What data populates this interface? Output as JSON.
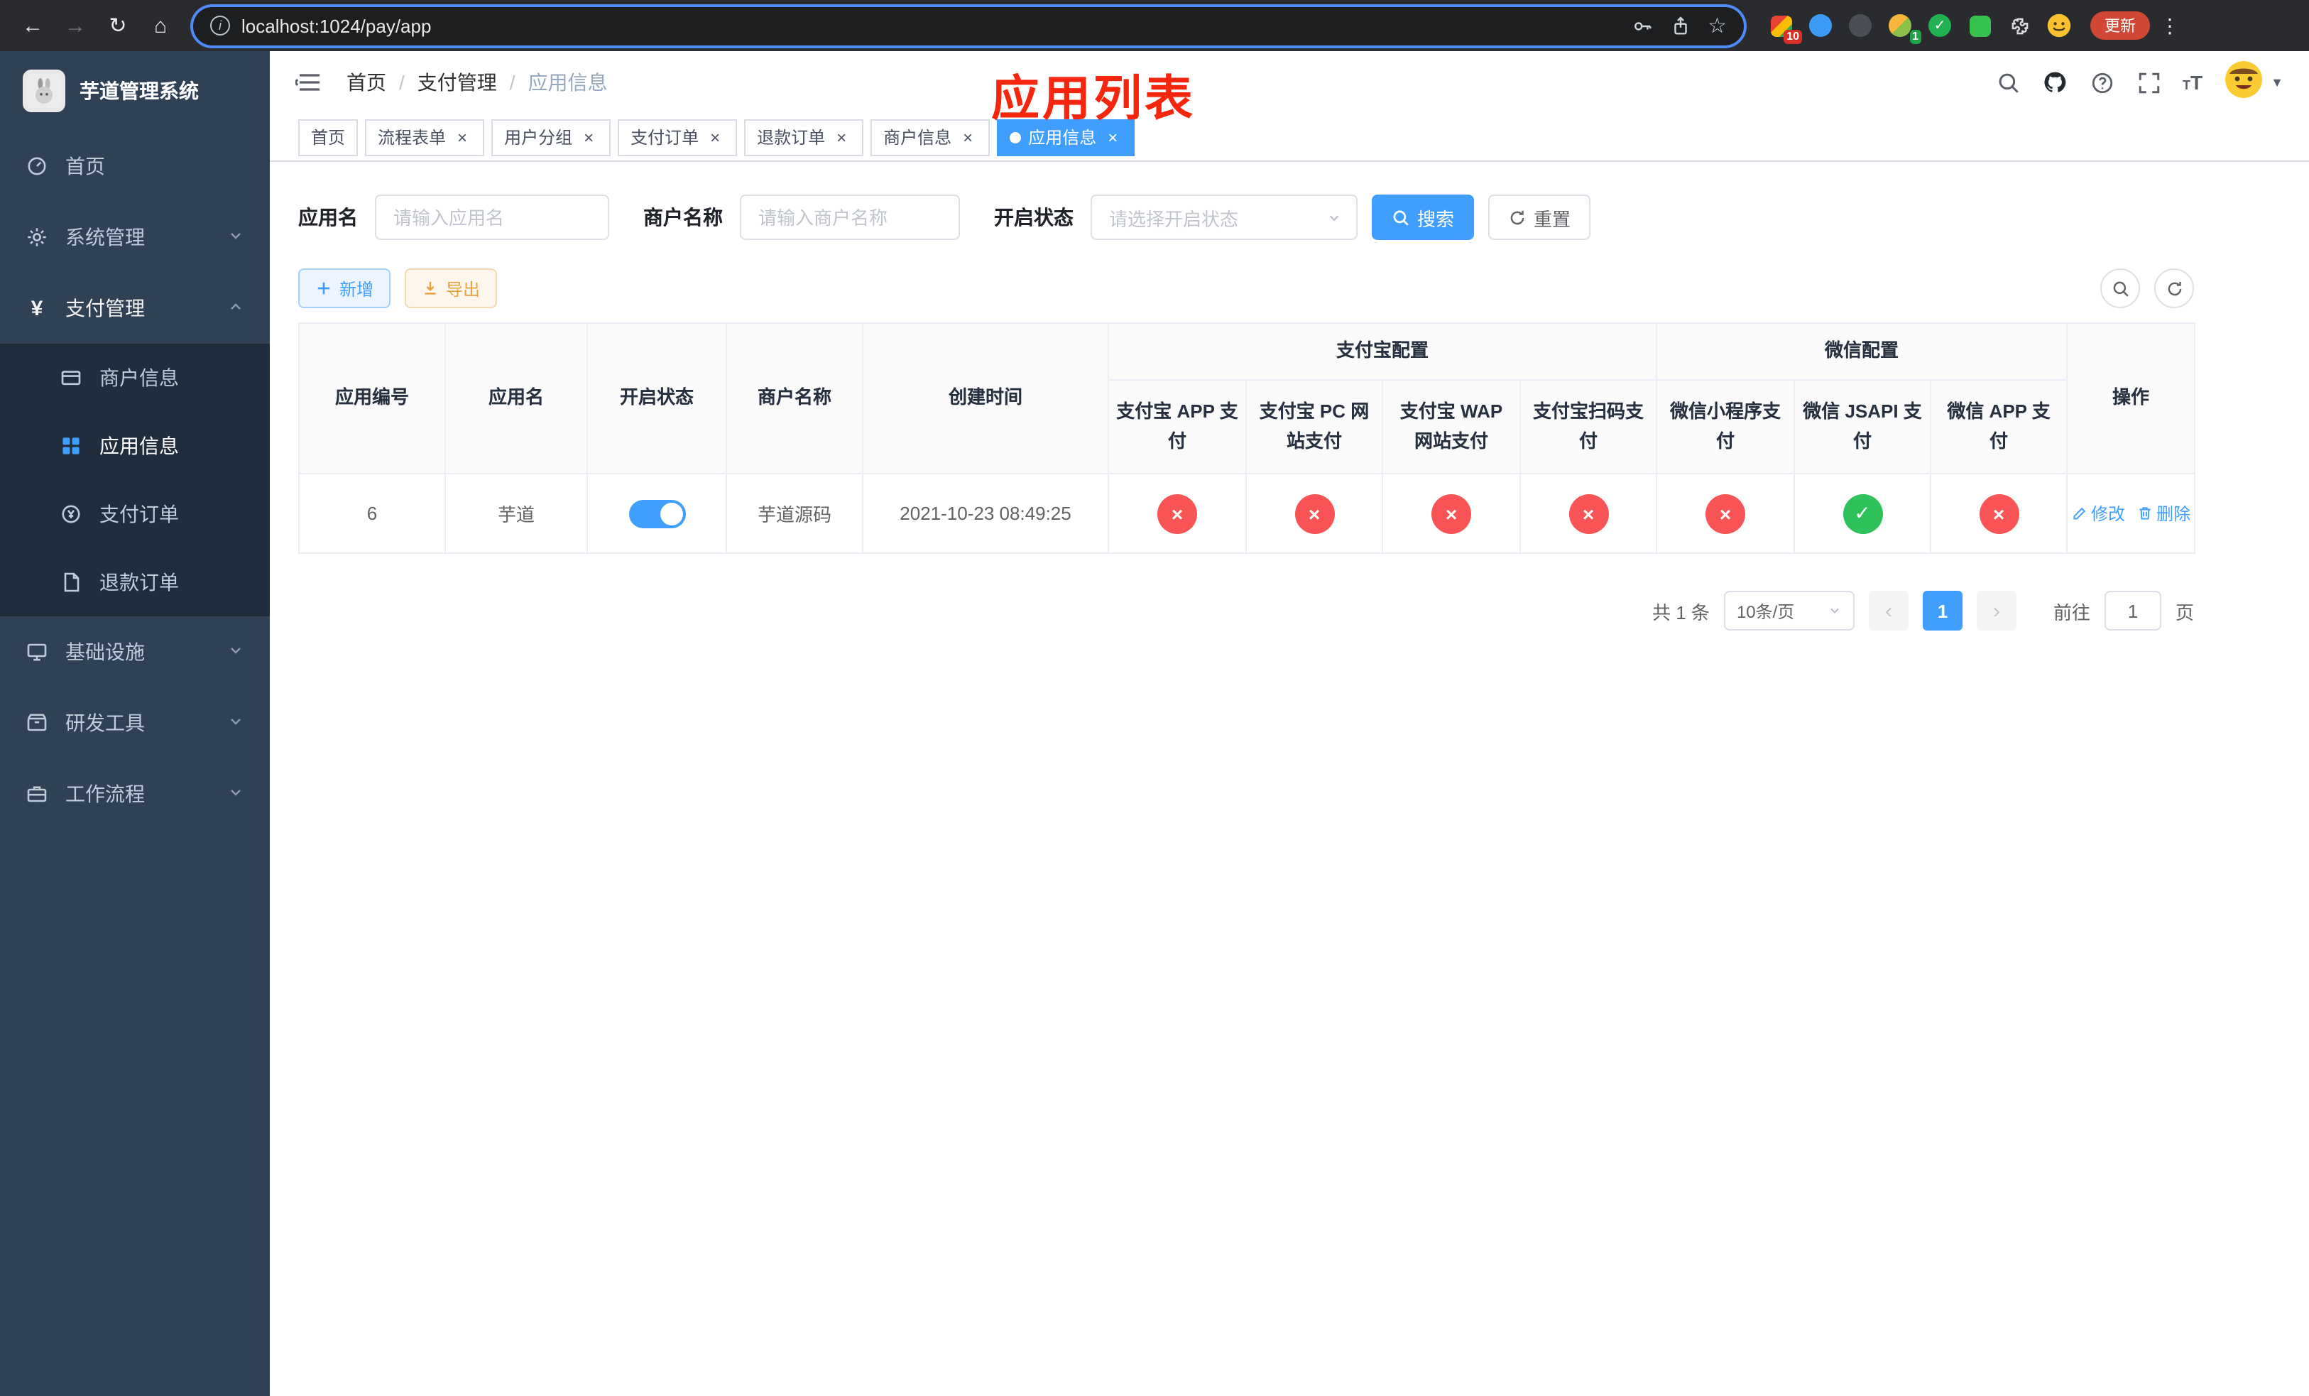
{
  "browser": {
    "url": "localhost:1024/pay/app",
    "update_label": "更新",
    "extension_badges": {
      "grid": "10",
      "avatar": "1"
    }
  },
  "sidebar": {
    "title": "芋道管理系统",
    "items": [
      {
        "label": "首页"
      },
      {
        "label": "系统管理"
      },
      {
        "label": "支付管理"
      },
      {
        "label": "基础设施"
      },
      {
        "label": "研发工具"
      },
      {
        "label": "工作流程"
      }
    ],
    "payment_children": [
      {
        "label": "商户信息"
      },
      {
        "label": "应用信息"
      },
      {
        "label": "支付订单"
      },
      {
        "label": "退款订单"
      }
    ]
  },
  "header": {
    "breadcrumb": [
      {
        "label": "首页"
      },
      {
        "label": "支付管理"
      },
      {
        "label": "应用信息"
      }
    ],
    "annotation": "应用列表"
  },
  "tabs": [
    {
      "label": "首页"
    },
    {
      "label": "流程表单"
    },
    {
      "label": "用户分组"
    },
    {
      "label": "支付订单"
    },
    {
      "label": "退款订单"
    },
    {
      "label": "商户信息"
    },
    {
      "label": "应用信息"
    }
  ],
  "filters": {
    "app_name": {
      "label": "应用名",
      "placeholder": "请输入应用名"
    },
    "merchant_name": {
      "label": "商户名称",
      "placeholder": "请输入商户名称"
    },
    "status": {
      "label": "开启状态",
      "placeholder": "请选择开启状态"
    },
    "search_label": "搜索",
    "reset_label": "重置"
  },
  "toolbar": {
    "add_label": "新增",
    "export_label": "导出"
  },
  "table": {
    "headers": {
      "id": "应用编号",
      "name": "应用名",
      "status": "开启状态",
      "merchant": "商户名称",
      "created": "创建时间",
      "alipay_group": "支付宝配置",
      "wechat_group": "微信配置",
      "actions": "操作",
      "alipay_cols": [
        "支付宝 APP 支付",
        "支付宝 PC 网站支付",
        "支付宝 WAP 网站支付",
        "支付宝扫码支付"
      ],
      "wechat_cols": [
        "微信小程序支付",
        "微信 JSAPI 支付",
        "微信 APP 支付"
      ]
    },
    "rows": [
      {
        "id": "6",
        "name": "芋道",
        "enabled": true,
        "merchant": "芋道源码",
        "created": "2021-10-23 08:49:25",
        "channels": {
          "alipay_app": false,
          "alipay_pc": false,
          "alipay_wap": false,
          "alipay_qr": false,
          "wechat_lite": false,
          "wechat_jsapi": true,
          "wechat_app": false
        },
        "edit_label": "修改",
        "delete_label": "删除"
      }
    ]
  },
  "pagination": {
    "total": "共 1 条",
    "page_size": "10条/页",
    "page": "1",
    "goto_label": "前往",
    "goto_value": "1",
    "goto_unit": "页"
  },
  "colors": {
    "accent": "#409eff",
    "success": "#2fc25b",
    "danger": "#f85455",
    "warning": "#e6a23c",
    "sidebar_bg": "#304156",
    "sidebar_submenu_bg": "#1f2d3d",
    "tab_active_bg": "#409eff",
    "annotation": "#f5260d",
    "browser_bar_bg": "#2a2b2e"
  }
}
